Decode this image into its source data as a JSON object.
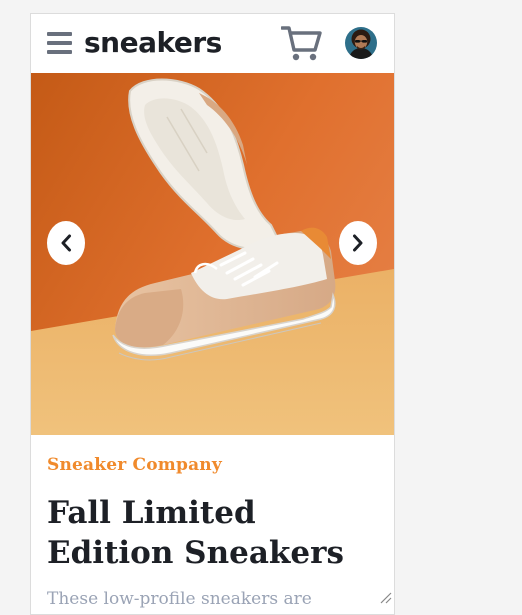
{
  "header": {
    "logo_text": "sneakers",
    "menu_icon": "hamburger-menu-icon",
    "cart_icon": "shopping-cart-icon",
    "avatar_icon": "user-avatar"
  },
  "gallery": {
    "prev_icon": "chevron-left-icon",
    "next_icon": "chevron-right-icon",
    "image_icon": "sneaker-product-photo"
  },
  "product": {
    "company": "Sneaker Company",
    "title": "Fall Limited Edition Sneakers",
    "description": "These low-profile sneakers are"
  },
  "colors": {
    "accent": "#f08a2c",
    "text_dark": "#1d2026",
    "text_muted": "#9aa3b5",
    "icon_gray": "#69707d"
  }
}
